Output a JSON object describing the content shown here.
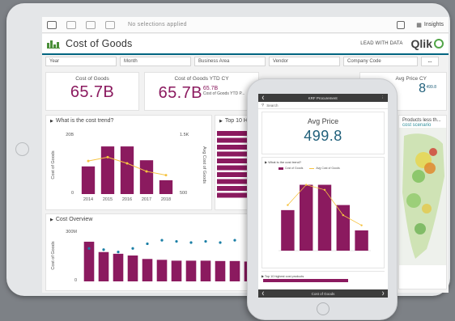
{
  "toolbar": {
    "no_selections": "No selections applied",
    "insights_label": "Insights"
  },
  "header": {
    "title": "Cost of Goods",
    "tagline": "LEAD WITH DATA",
    "brand": "Qlik"
  },
  "filters": [
    "Year",
    "Month",
    "Business Area",
    "Vendor",
    "Company Code"
  ],
  "filters_more": "...",
  "kpis": {
    "cost_of_goods": {
      "label": "Cost of Goods",
      "value": "65.7B"
    },
    "cost_ytd": {
      "label": "Cost of Goods YTD CY",
      "value": "65.7B",
      "side_value": "65.7B",
      "side_label": "Cost of Goods YTD P..."
    },
    "avg_price": {
      "label": "Avg Price CY",
      "value": "8",
      "side": "499.8"
    }
  },
  "trend_panel": {
    "title": "What is the cost trend?",
    "ylabel_left": "Cost of Goods",
    "ylabel_right": "Avg Cost of Goods",
    "ylim_left_top": "20B",
    "ylim_right_top": "1.5K",
    "ylim_right_bottom": "500",
    "ylim_left_bottom": "0",
    "categories": [
      "2014",
      "2015",
      "2016",
      "2017",
      "2018"
    ]
  },
  "top_panel": {
    "title": "Top 10 Hig..."
  },
  "map_panel": {
    "title": "Products less th...",
    "subtitle": "cost scenario"
  },
  "overview_panel": {
    "title": "Cost Overview",
    "ylabel": "Cost of Goods",
    "ytick_top": "300M",
    "ytick_bottom": "0"
  },
  "chart_data": [
    {
      "type": "bar",
      "title": "What is the cost trend?",
      "categories": [
        "2014",
        "2015",
        "2016",
        "2017",
        "2018"
      ],
      "series": [
        {
          "name": "Cost of Goods",
          "values": [
            9,
            15.5,
            15.5,
            11,
            4.5
          ]
        },
        {
          "name": "Avg Cost of Goods",
          "values": [
            1000,
            1080,
            950,
            780,
            700
          ]
        }
      ],
      "ylim": [
        0,
        20
      ]
    },
    {
      "type": "bar",
      "title": "Cost Overview",
      "values": [
        230,
        170,
        160,
        150,
        130,
        125,
        120,
        120,
        120,
        118,
        118,
        115,
        112,
        110
      ],
      "secondary": [
        140,
        135,
        125,
        140,
        160,
        175,
        170,
        165,
        170,
        165,
        175,
        170,
        160,
        165
      ]
    },
    {
      "type": "bar",
      "title": "What is the cost trend?",
      "series": [
        {
          "name": "Cost of Goods",
          "values": [
            8,
            13,
            13,
            9,
            4
          ]
        },
        {
          "name": "Avg Cost of Goods",
          "values": [
            900,
            1300,
            1200,
            700,
            500
          ]
        }
      ]
    }
  ],
  "phone": {
    "top_title": "KRF Procurement",
    "search_label": "Search",
    "kpi_label": "Avg Price",
    "kpi_value": "499.8",
    "chart_title": "What is the cost trend?",
    "legend": [
      "Cost of Goods",
      "Avg Cost of Goods"
    ],
    "subpanel_title": "Top 10 highest cost products",
    "nav_label": "Cost of Goods"
  },
  "colors": {
    "bar": "#8b1a5f",
    "line": "#f6c340",
    "accent": "#006580",
    "brand_green": "#52a548",
    "dot_blue": "#1b7fa6",
    "kpi_blue": "#1f5f7a"
  }
}
